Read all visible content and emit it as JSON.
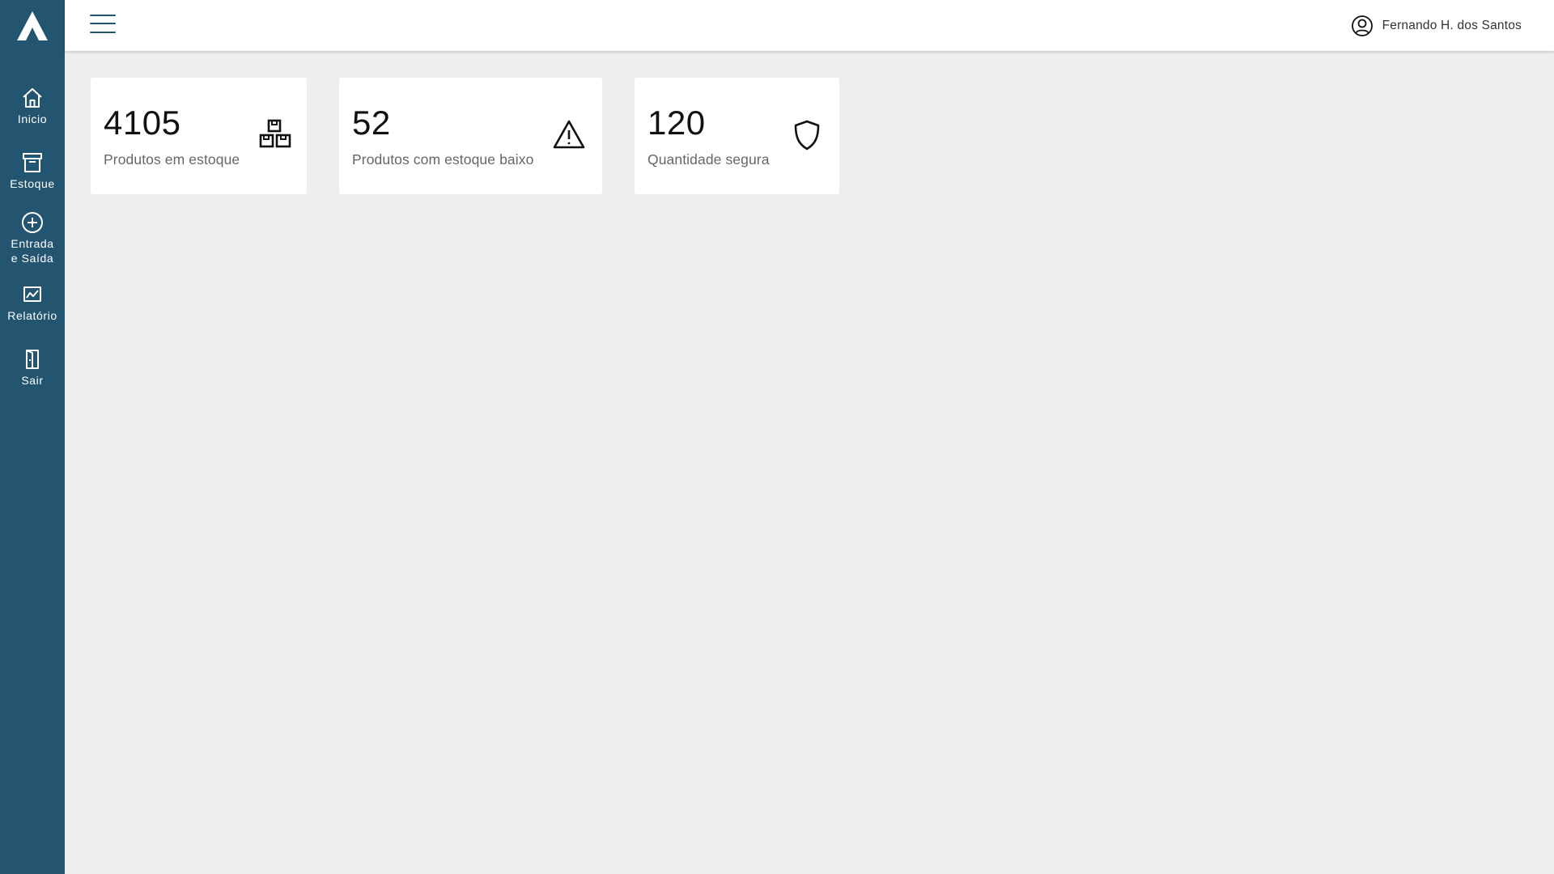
{
  "sidebar": {
    "logo_icon": "triangle-logo-icon",
    "items": [
      {
        "label": "Inicio",
        "icon": "home-icon"
      },
      {
        "label": "Estoque",
        "icon": "archive-icon"
      },
      {
        "label_line1": "Entrada",
        "label_line2": "e Saída",
        "icon": "plus-circle-icon"
      },
      {
        "label": "Relatório",
        "icon": "chart-icon"
      },
      {
        "label": "Sair",
        "icon": "door-icon"
      }
    ],
    "background_color": "#245570"
  },
  "header": {
    "menu_icon": "hamburger-menu-icon",
    "user_icon": "user-circle-icon",
    "user_name": "Fernando H. dos Santos"
  },
  "cards": [
    {
      "value": "4105",
      "label": "Produtos em estoque",
      "icon": "boxes-icon"
    },
    {
      "value": "52",
      "label": "Produtos com estoque baixo",
      "icon": "warning-triangle-icon"
    },
    {
      "value": "120",
      "label": "Quantidade segura",
      "icon": "shield-icon"
    }
  ],
  "colors": {
    "accent": "#245570",
    "background": "#eeeeee",
    "card": "#ffffff"
  }
}
